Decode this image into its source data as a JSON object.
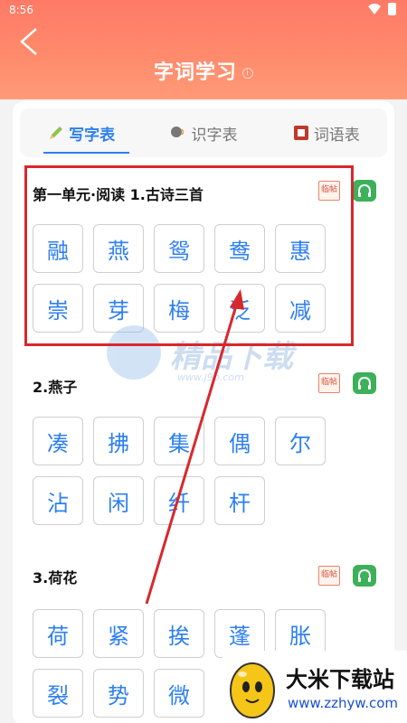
{
  "status": {
    "time": "8:56"
  },
  "header": {
    "title": "字词学习",
    "info": "i"
  },
  "tabs": [
    {
      "label": "写字表"
    },
    {
      "label": "识字表"
    },
    {
      "label": "词语表"
    }
  ],
  "sections": [
    {
      "title": "第一单元·阅读 1.古诗三首",
      "stamp": "临帖",
      "chars": [
        "融",
        "燕",
        "鸳",
        "鸯",
        "惠",
        "崇",
        "芽",
        "梅",
        "泛",
        "减"
      ]
    },
    {
      "title": "2.燕子",
      "stamp": "临帖",
      "chars": [
        "凑",
        "拂",
        "集",
        "偶",
        "尔",
        "沾",
        "闲",
        "纤",
        "杆"
      ]
    },
    {
      "title": "3.荷花",
      "stamp": "临帖",
      "chars": [
        "荷",
        "紧",
        "挨",
        "蓬",
        "胀",
        "裂",
        "势",
        "微"
      ]
    }
  ],
  "watermark": {
    "text": "精品下载",
    "sub": "www.j9p.com"
  },
  "brand": {
    "name": "大米下载站",
    "url": "www.zzhyw.com"
  },
  "colors": {
    "accent": "#2d7ff0",
    "header": "#ff8a6b",
    "annotation": "#d8282c",
    "audio": "#3db05a"
  }
}
